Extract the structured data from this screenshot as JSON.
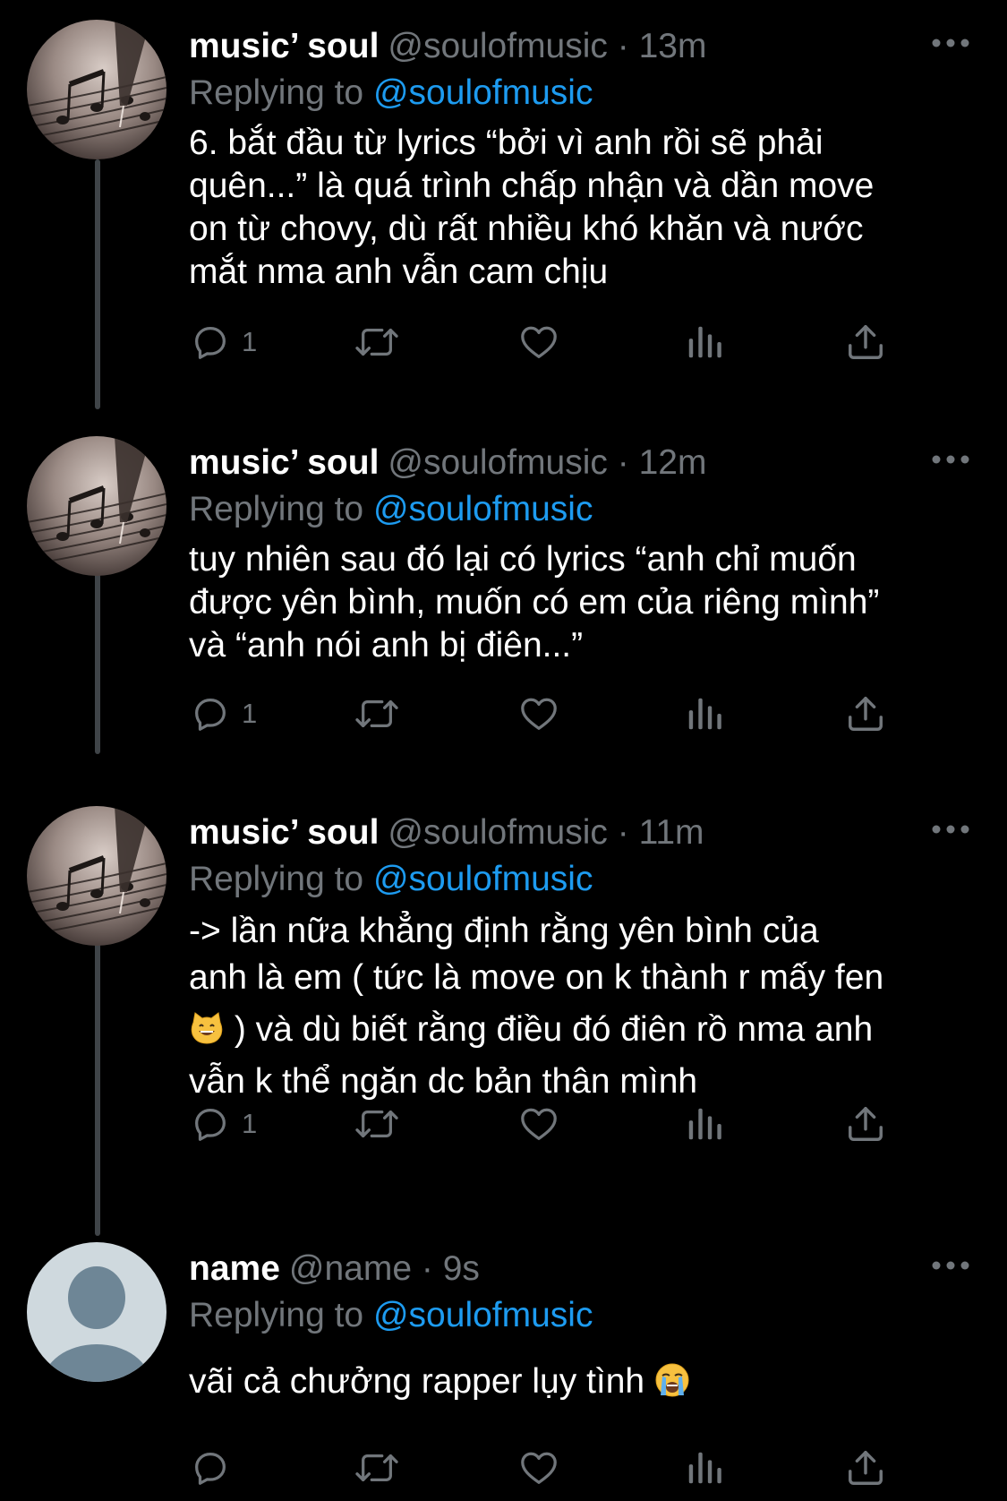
{
  "colors": {
    "background": "#000000",
    "text": "#ffffff",
    "muted": "#71767b",
    "accent": "#1d9bf0",
    "thread_line": "#3f4448"
  },
  "reply_prefix": "Replying to",
  "tweets": [
    {
      "name": "music’ soul",
      "meta": "@soulofmusic · 13m",
      "reply_to": "@soulofmusic",
      "text": "6. bắt đầu từ lyrics “bởi vì anh rồi sẽ phải\nquên...” là quá trình chấp nhận và dần move\non từ chovy, dù rất nhiều khó khăn và nước\nmắt nma anh vẫn cam chịu",
      "reply_count": "1",
      "avatar_icon": "music-sheet-avatar"
    },
    {
      "name": "music’ soul",
      "meta": "@soulofmusic · 12m",
      "reply_to": "@soulofmusic",
      "text": "tuy nhiên sau đó lại có lyrics “anh chỉ muốn\nđược yên bình, muốn có em của riêng mình”\nvà “anh nói anh bị điên...”",
      "reply_count": "1",
      "avatar_icon": "music-sheet-avatar"
    },
    {
      "name": "music’ soul",
      "meta": "@soulofmusic · 11m",
      "reply_to": "@soulofmusic",
      "text_line1": "-> lần nữa khẳng định rằng yên bình của",
      "text_line2": "anh là em ( tức là move on k thành r mấy fen",
      "text_line3": " ) và dù biết rằng điều đó điên rồ nma anh",
      "text_line4": "vẫn k thể ngăn dc bản thân mình",
      "emoji_icon": "grinning-cat-emoji",
      "reply_count": "1",
      "avatar_icon": "music-sheet-avatar"
    },
    {
      "name": "name",
      "meta": "@name · 9s",
      "reply_to": "@soulofmusic",
      "text": "vãi cả chưởng rapper lụy tình ",
      "emoji_icon": "loudly-crying-face-emoji",
      "reply_count": "",
      "avatar_icon": "default-profile-avatar"
    }
  ]
}
